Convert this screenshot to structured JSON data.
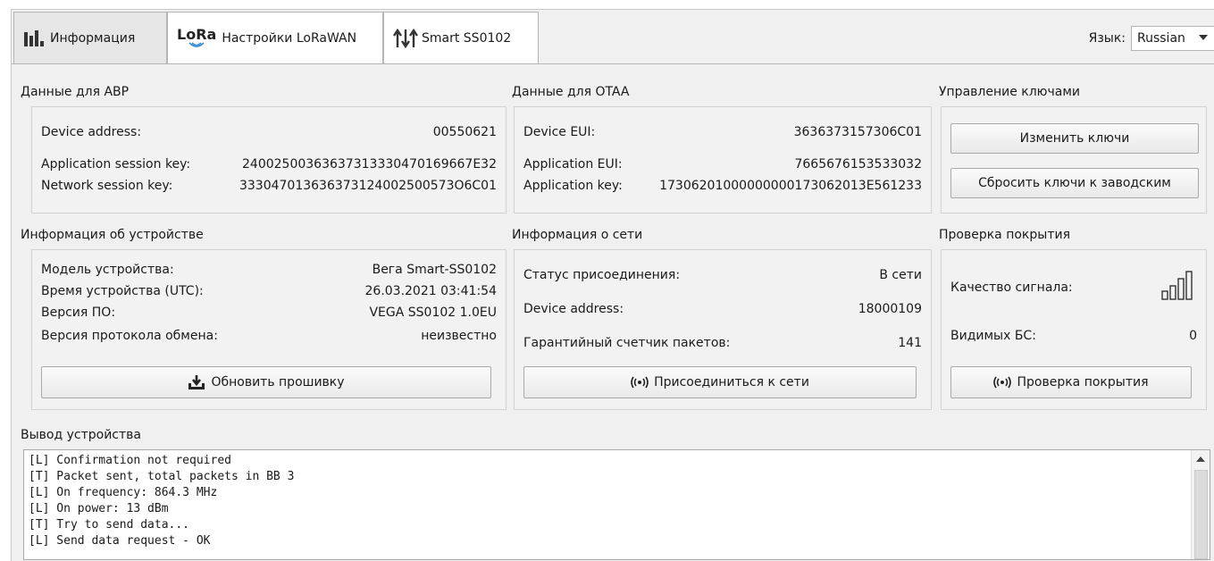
{
  "tabs": [
    {
      "label": "Информация",
      "active": true,
      "icon": "bar-chart-icon"
    },
    {
      "label": "Настройки LoRaWAN",
      "active": false,
      "icon": "lora-logo-icon",
      "logo_text": "LoRa"
    },
    {
      "label": "Smart SS0102",
      "active": false,
      "icon": "arrows-updown-icon"
    }
  ],
  "language": {
    "label": "Язык:",
    "value": "Russian"
  },
  "abp": {
    "title": "Данные для ABP",
    "rows": [
      {
        "label": "Device address:",
        "value": "00550621"
      },
      {
        "label": "Application session key:",
        "value": "24002500363637313330470169667E32"
      },
      {
        "label": "Network session key:",
        "value": "333047013636373124002500573O6C01"
      }
    ]
  },
  "otaa": {
    "title": "Данные для OTAA",
    "rows": [
      {
        "label": "Device EUI:",
        "value": "3636373157306C01"
      },
      {
        "label": "Application EUI:",
        "value": "7665676153533032"
      },
      {
        "label": "Application key:",
        "value": "17306201000000000173062013E561233"
      }
    ]
  },
  "keys": {
    "title": "Управление ключами",
    "change_button": "Изменить ключи",
    "reset_button": "Сбросить ключи к заводским"
  },
  "device_info": {
    "title": "Информация об устройстве",
    "rows": [
      {
        "label": "Модель устройства:",
        "value": "Вега Smart-SS0102"
      },
      {
        "label": "Время устройства (UTC):",
        "value": "26.03.2021 03:41:54"
      },
      {
        "label": "Версия ПО:",
        "value": "VEGA SS0102 1.0EU"
      },
      {
        "label": "Версия протокола обмена:",
        "value": "неизвестно"
      }
    ],
    "update_button": "Обновить прошивку"
  },
  "network_info": {
    "title": "Информация о сети",
    "rows": [
      {
        "label": "Статус присоединения:",
        "value": "В сети"
      },
      {
        "label": "Device address:",
        "value": "18000109"
      },
      {
        "label": "Гарантийный счетчик пакетов:",
        "value": "141"
      }
    ],
    "join_button": "Присоединиться к сети"
  },
  "coverage": {
    "title": "Проверка покрытия",
    "signal_label": "Качество сигнала:",
    "signal_level": 0,
    "stations_label": "Видимых БС:",
    "stations_value": "0",
    "check_button": "Проверка покрытия"
  },
  "output": {
    "title": "Вывод устройства",
    "lines": [
      "[L] Confirmation not required",
      "[T] Packet sent, total packets in BB 3",
      "[L] On frequency: 864.3 MHz",
      "[L] On power: 13 dBm",
      "[T] Try to send data...",
      "[L] Send data request - OK"
    ]
  }
}
